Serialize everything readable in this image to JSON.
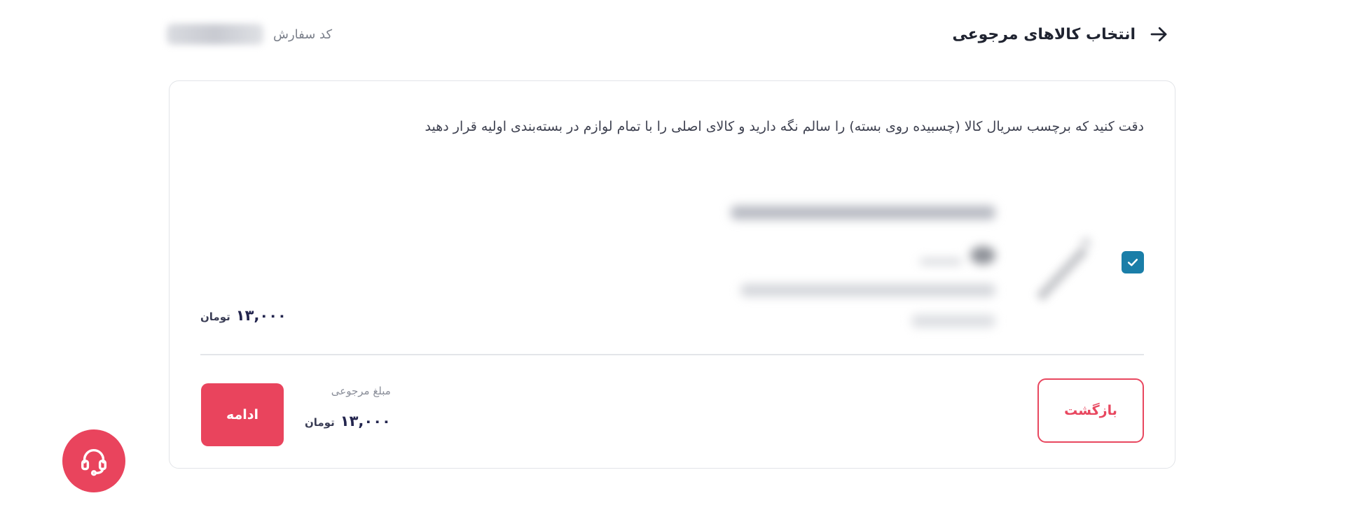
{
  "header": {
    "title": "انتخاب کالاهای مرجوعی",
    "back_icon": "arrow-right-icon",
    "order_code_label": "کد سفارش"
  },
  "notice": {
    "text": "دقت کنید که برچسب سریال کالا (چسبیده روی بسته) را سالم نگه دارید و کالای اصلی را با تمام لوازم در بسته‌بندی اولیه قرار دهید"
  },
  "item": {
    "selected": true,
    "checkbox_icon": "check-icon",
    "price_amount": "۱۳,۰۰۰",
    "price_currency": "تومان"
  },
  "footer": {
    "return_label": "بازگشت",
    "refund_label": "مبلغ مرجوعی",
    "refund_amount": "۱۳,۰۰۰",
    "refund_currency": "تومان",
    "continue_label": "ادامه"
  },
  "support": {
    "icon": "headset-icon"
  },
  "colors": {
    "accent": "#e9445d",
    "checkbox": "#1a7ea8",
    "text_dark": "#23254e",
    "border": "#e2e4e8"
  }
}
